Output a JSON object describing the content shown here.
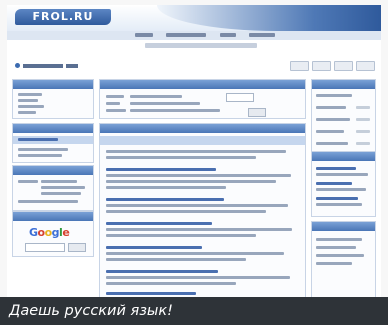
{
  "site": {
    "logo_text": "FROL.RU"
  },
  "caption": "Даешь русский язык!",
  "colors": {
    "header_blue": "#2f5a9c",
    "box_caption_blue": "#4a76b6",
    "caption_bar": "#2e3338"
  }
}
